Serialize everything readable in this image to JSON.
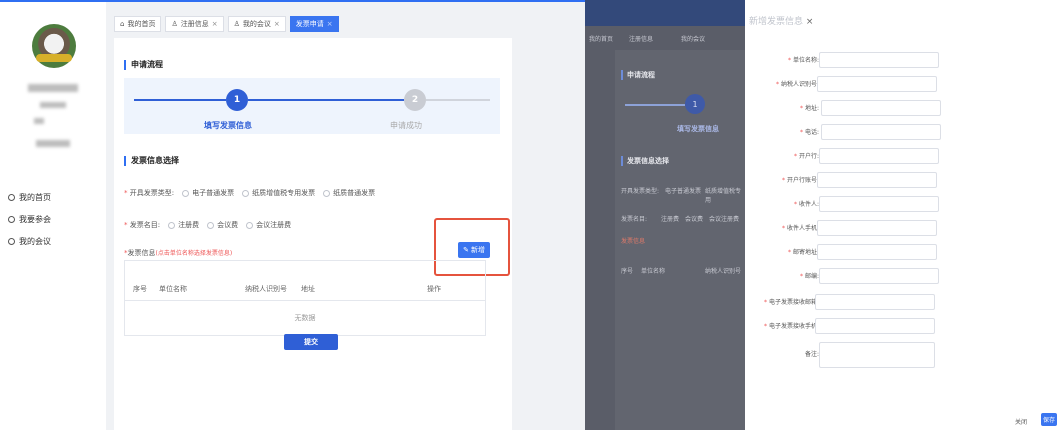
{
  "sidebar": {
    "items": [
      {
        "label": "我的首页"
      },
      {
        "label": "我要参会"
      },
      {
        "label": "我的会议"
      }
    ]
  },
  "tabs": [
    {
      "label": "我的首页",
      "closable": false
    },
    {
      "label": "注册信息",
      "closable": true
    },
    {
      "label": "我的会议",
      "closable": true
    },
    {
      "label": "发票申请",
      "closable": true,
      "active": true
    }
  ],
  "main": {
    "flow_title": "申请流程",
    "steps": [
      {
        "num": "1",
        "label": "填写发票信息",
        "active": true
      },
      {
        "num": "2",
        "label": "申请成功",
        "active": false
      }
    ],
    "select_title": "发票信息选择",
    "invoice_type_label": "开具发票类型:",
    "invoice_types": [
      "电子普通发票",
      "纸质增值税专用发票",
      "纸质普通发票"
    ],
    "invoice_name_label": "发票名目:",
    "invoice_names": [
      "注册费",
      "会议费",
      "会议注册费"
    ],
    "invoice_info_label": "发票信息",
    "invoice_info_hint": "(点击单位名称选择发票信息)",
    "add_button": "新增",
    "table_headers": [
      "序号",
      "单位名称",
      "纳税人识别号",
      "地址",
      "操作"
    ],
    "empty_text": "无数据",
    "submit_button": "提交"
  },
  "background_page": {
    "tabs": [
      "我的首页",
      "注册信息",
      "我的会议"
    ],
    "flow_title": "申请流程",
    "step1_num": "1",
    "step1_label": "填写发票信息",
    "select_title": "发票信息选择",
    "invoice_type_label": "开具发票类型:",
    "invoice_types": [
      "电子普通发票",
      "纸质增值税专用"
    ],
    "invoice_name_label": "发票名目:",
    "invoice_names": [
      "注册费",
      "会议费",
      "会议注册费"
    ],
    "invoice_info_label": "发票信息",
    "table_headers": [
      "序号",
      "单位名称",
      "纳税人识别号"
    ]
  },
  "drawer": {
    "title": "新增发票信息",
    "close_x": "×",
    "fields": [
      {
        "label": "单位名称:",
        "required": true
      },
      {
        "label": "纳税人识别号:",
        "required": true
      },
      {
        "label": "地址:",
        "required": true
      },
      {
        "label": "电话:",
        "required": true
      },
      {
        "label": "开户行:",
        "required": true
      },
      {
        "label": "开户行账号:",
        "required": true
      },
      {
        "label": "收件人:",
        "required": true
      },
      {
        "label": "收件人手机:",
        "required": true
      },
      {
        "label": "邮寄地址:",
        "required": true
      },
      {
        "label": "邮编:",
        "required": true
      },
      {
        "label": "电子发票接收邮箱:",
        "required": true
      },
      {
        "label": "电子发票接收手机:",
        "required": true
      }
    ],
    "remark_label": "备注:",
    "close_button": "关闭",
    "save_button": "保存"
  },
  "colors": {
    "accent": "#3a75f0",
    "highlight_box": "#e5533d",
    "required": "#e55555"
  }
}
